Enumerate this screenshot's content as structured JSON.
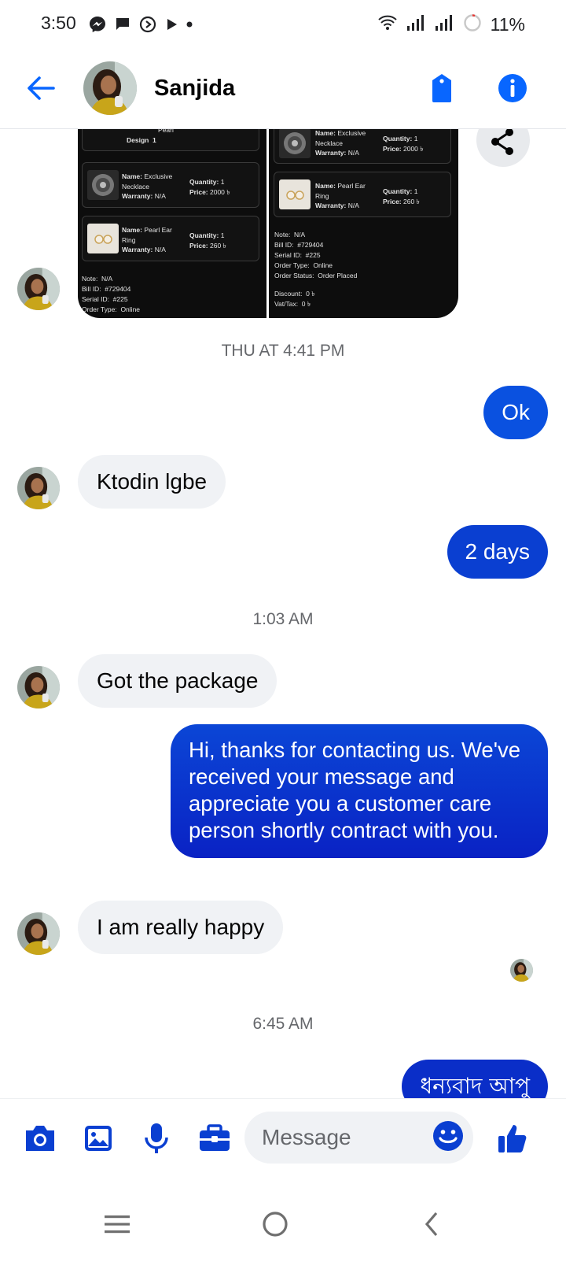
{
  "status_bar": {
    "time": "3:50",
    "battery": "11%",
    "notification_icons": [
      "messenger-icon",
      "chat-icon",
      "smartswitch-icon",
      "play-icon",
      "dot-icon"
    ],
    "system_icons": [
      "wifi-icon",
      "signal-icon",
      "signal-icon",
      "battery-icon"
    ]
  },
  "header": {
    "contact_name": "Sanjida",
    "back_icon": "back-arrow-icon",
    "tag_icon": "tag-icon",
    "info_icon": "info-icon"
  },
  "receipt": {
    "left": {
      "top_lines": [
        "Pearl",
        "Design  1"
      ],
      "items": [
        {
          "name_label": "Name:",
          "name": "Exclusive\nNecklace",
          "warranty_label": "Warranty:",
          "warranty": "N/A",
          "qty_label": "Quantity:",
          "qty": "1",
          "price_label": "Price:",
          "price": "2000 ৳"
        },
        {
          "name_label": "Name:",
          "name": "Pearl Ear\nRing",
          "warranty_label": "Warranty:",
          "warranty": "N/A",
          "qty_label": "Quantity:",
          "qty": "1",
          "price_label": "Price:",
          "price": "260 ৳"
        }
      ],
      "footer": [
        "Note:  N/A",
        "Bill ID:  #729404",
        "Serial ID:  #225",
        "Order Type:  Online"
      ]
    },
    "right": {
      "items": [
        {
          "name_label": "Name:",
          "name": "Exclusive\nNecklace",
          "warranty_label": "Warranty:",
          "warranty": "N/A",
          "qty_label": "Quantity:",
          "qty": "1",
          "price_label": "Price:",
          "price": "2000 ৳"
        },
        {
          "name_label": "Name:",
          "name": "Pearl Ear\nRing",
          "warranty_label": "Warranty:",
          "warranty": "N/A",
          "qty_label": "Quantity:",
          "qty": "1",
          "price_label": "Price:",
          "price": "260 ৳"
        }
      ],
      "footer": [
        "Note:  N/A",
        "Bill ID:  #729404",
        "Serial ID:  #225",
        "Order Type:  Online",
        "Order Status:  Order Placed",
        "",
        "Discount:  0 ৳",
        "Vat/Tax:  0 ৳"
      ]
    }
  },
  "messages": {
    "ts1": "THU AT 4:41 PM",
    "out_ok": "Ok",
    "in_ktodin": "Ktodin lgbe",
    "out_2days": "2 days",
    "ts2": "1:03 AM",
    "in_package": "Got the package",
    "out_long": "Hi, thanks for contacting us. We've received your message and appreciate you a customer care person shortly contract with you.",
    "in_happy": "I am really happy",
    "ts3": "6:45 AM",
    "out_bangla": "ধন্যবাদ আপু"
  },
  "composer": {
    "placeholder": "Message",
    "icons": [
      "camera-icon",
      "gallery-icon",
      "microphone-icon",
      "briefcase-icon",
      "emoji-icon",
      "thumbs-up-icon"
    ]
  },
  "colors": {
    "brand_blue": "#0866ff",
    "bubble_blue": "#0a3fd1",
    "bubble_gray": "#f0f2f5",
    "muted_text": "#65676b"
  }
}
